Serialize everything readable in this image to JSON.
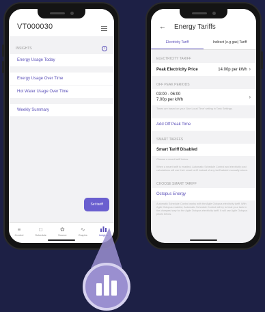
{
  "left_screen": {
    "title": "VT000030",
    "section_label": "INSIGHTS",
    "items": [
      "Energy Usage Today",
      "Energy Usage Over Time",
      "Hot Water Usage Over Time",
      "Weekly Summary"
    ],
    "set_tariff_label": "Set tariff",
    "tabs": [
      {
        "label": "Control",
        "icon": "sliders-icon"
      },
      {
        "label": "Schedule",
        "icon": "calendar-icon"
      },
      {
        "label": "Source",
        "icon": "flame-icon"
      },
      {
        "label": "Graphs",
        "icon": "line-graph-icon"
      },
      {
        "label": "Insights",
        "icon": "bar-chart-icon"
      }
    ],
    "active_tab": "Insights"
  },
  "right_screen": {
    "title": "Energy Tariffs",
    "tabs": [
      "Electricity Tariff",
      "Indirect (e.g gas) Tariff"
    ],
    "electricity_tariff_label": "ELECTRICITY TARIFF",
    "peak_label": "Peak Electricity Price",
    "peak_value": "14.00p per kWh",
    "off_peak_label": "OFF PEAK PERIODS",
    "off_peak_time": "03:00 - 06:00",
    "off_peak_price": "7.00p per kWh",
    "off_peak_note": "Times are based on your 'Use Local Time' setting in Tank Settings.",
    "add_off_peak": "Add Off Peak Time",
    "smart_tariffs_label": "SMART TARIFFS",
    "smart_tariff_status": "Smart Tariff Disabled",
    "smart_note_1": "Choose a smart tariff below.",
    "smart_note_2": "When a smart tariff is enabled, Automatic Schedule Control and electricity cost calculations will use their smart tariff instead of any tariff added manually above.",
    "choose_label": "CHOOSE SMART TARIFF",
    "octopus": "Octopus Energy",
    "octopus_note": "Automatic Schedule Control works with the Agile Octopus electricity tariff. With Agile Octopus enabled, Automatic Schedule Control will try to heat your tank in the cheapest way for the Agile Octopus electricity tariff. It will use Agile Octopus prices below."
  },
  "colors": {
    "background": "#1d2045",
    "accent": "#5a4fb8",
    "callout": "#9a8fd0"
  },
  "callout_icon": "bar-chart-icon"
}
